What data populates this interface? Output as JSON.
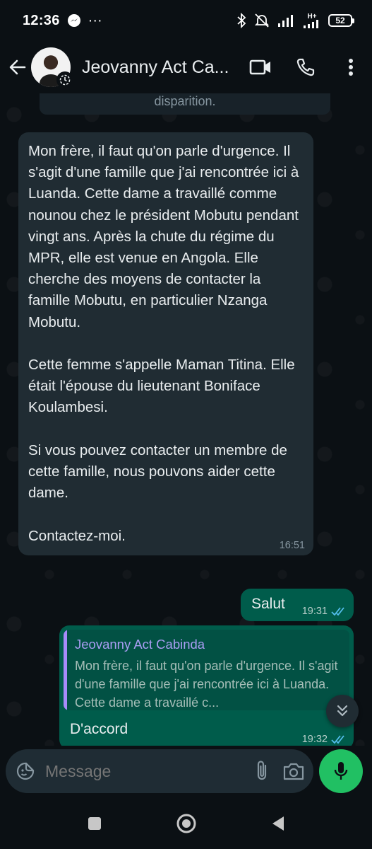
{
  "status_bar": {
    "time": "12:36",
    "more": "···",
    "battery": "52",
    "network": "H+"
  },
  "header": {
    "contact_name": "Jeovanny Act Ca...",
    "back_icon": "arrow-left-icon",
    "video_icon": "video-camera-icon",
    "call_icon": "phone-icon",
    "menu_icon": "kebab-menu-icon"
  },
  "chat": {
    "system_message": "disparition.",
    "incoming": {
      "text": "Mon frère, il faut qu'on parle d'urgence. Il s'agit d'une famille que j'ai rencontrée ici à Luanda. Cette dame a travaillé comme nounou chez le président Mobutu pendant vingt ans. Après la chute du régime du MPR, elle est venue en Angola. Elle cherche des moyens de contacter la famille Mobutu, en particulier Nzanga Mobutu.\n\nCette femme s'appelle Maman Titina. Elle était l'épouse du lieutenant Boniface Koulambesi.\n\nSi vous pouvez contacter un membre de cette famille, nous pouvons aider cette dame.\n\nContactez-moi.",
      "time": "16:51"
    },
    "outgoing_1": {
      "text": "Salut",
      "time": "19:31"
    },
    "outgoing_2": {
      "quote_name": "Jeovanny Act Cabinda",
      "quote_text": "Mon frère, il faut qu'on parle d'urgence. Il s'agit d'une famille que j'ai rencontrée ici à Luanda. Cette dame a travaillé c...",
      "text": "D'accord",
      "time": "19:32"
    }
  },
  "input": {
    "placeholder": "Message",
    "emoji_icon": "sticker-icon",
    "attach_icon": "paperclip-icon",
    "camera_icon": "camera-icon",
    "mic_icon": "microphone-icon"
  },
  "colors": {
    "background": "#0b1014",
    "incoming_bubble": "#202c33",
    "outgoing_bubble": "#005c4b",
    "accent_green": "#21c063",
    "read_ticks": "#53bdeb",
    "quote_bar": "#a78bfa"
  }
}
